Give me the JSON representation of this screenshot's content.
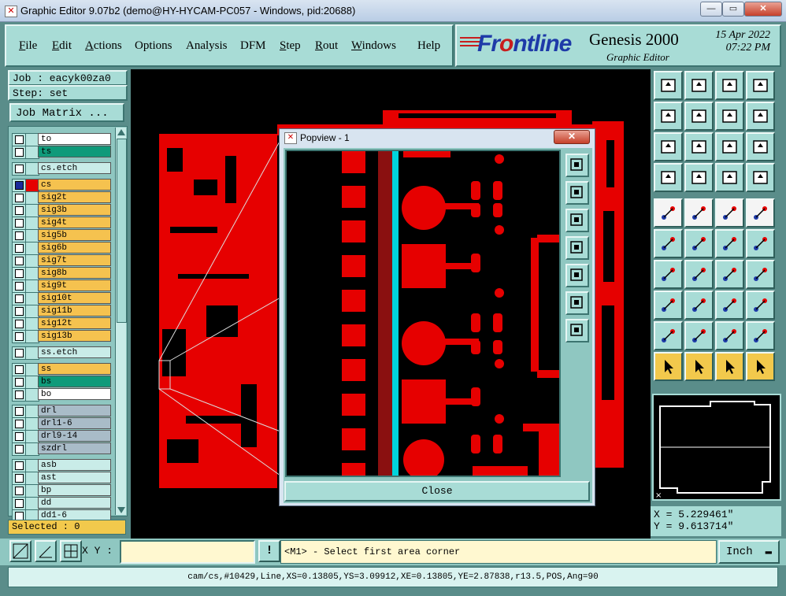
{
  "window": {
    "title": "Graphic Editor 9.07b2 (demo@HY-HYCAM-PC057 - Windows, pid:20688)",
    "app_icon": "x-icon",
    "controls": {
      "minimize": "—",
      "restore": "▭",
      "close": "✕"
    }
  },
  "menubar": {
    "items": [
      {
        "label": "File",
        "u": "F",
        "rest": "ile"
      },
      {
        "label": "Edit",
        "u": "E",
        "rest": "dit"
      },
      {
        "label": "Actions",
        "u": "A",
        "rest": "ctions"
      },
      {
        "label": "Options",
        "u": "",
        "rest": "Options"
      },
      {
        "label": "Analysis",
        "u": "",
        "rest": "Analysis"
      },
      {
        "label": "DFM",
        "u": "",
        "rest": "DFM"
      },
      {
        "label": "Step",
        "u": "S",
        "rest": "tep"
      },
      {
        "label": "Rout",
        "u": "R",
        "rest": "out"
      },
      {
        "label": "Windows",
        "u": "W",
        "rest": "indows"
      },
      {
        "label": "Help",
        "u": "",
        "rest": "Help"
      }
    ]
  },
  "logo": {
    "brand_pre": "Fr",
    "brand_o": "o",
    "brand_post": "ntline",
    "product": "Genesis 2000",
    "subtitle": "Graphic Editor",
    "date": "15 Apr 2022",
    "time": "07:22 PM"
  },
  "job": {
    "job_label": "Job : eacyk00za0",
    "step_label": "Step: set",
    "matrix_button": "Job Matrix ..."
  },
  "layers": [
    {
      "name": "to",
      "color": "#ffffff",
      "group": 1
    },
    {
      "name": "ts",
      "color": "#0f9a7a",
      "group": 1
    },
    {
      "name": "cs.etch",
      "color": "#c9ece8",
      "group": 2
    },
    {
      "name": "cs",
      "color": "#f5c24f",
      "group": 3,
      "active": true
    },
    {
      "name": "sig2t",
      "color": "#f5c24f",
      "group": 3
    },
    {
      "name": "sig3b",
      "color": "#f5c24f",
      "group": 3
    },
    {
      "name": "sig4t",
      "color": "#f5c24f",
      "group": 3
    },
    {
      "name": "sig5b",
      "color": "#f5c24f",
      "group": 3
    },
    {
      "name": "sig6b",
      "color": "#f5c24f",
      "group": 3
    },
    {
      "name": "sig7t",
      "color": "#f5c24f",
      "group": 3
    },
    {
      "name": "sig8b",
      "color": "#f5c24f",
      "group": 3
    },
    {
      "name": "sig9t",
      "color": "#f5c24f",
      "group": 3
    },
    {
      "name": "sig10t",
      "color": "#f5c24f",
      "group": 3
    },
    {
      "name": "sig11b",
      "color": "#f5c24f",
      "group": 3
    },
    {
      "name": "sig12t",
      "color": "#f5c24f",
      "group": 3
    },
    {
      "name": "sig13b",
      "color": "#f5c24f",
      "group": 3
    },
    {
      "name": "ss.etch",
      "color": "#c9ece8",
      "group": 4
    },
    {
      "name": "ss",
      "color": "#f5c24f",
      "group": 5
    },
    {
      "name": "bs",
      "color": "#0f9a7a",
      "group": 5
    },
    {
      "name": "bo",
      "color": "#ffffff",
      "group": 5
    },
    {
      "name": "drl",
      "color": "#a9bcc8",
      "group": 6
    },
    {
      "name": "drl1-6",
      "color": "#a9bcc8",
      "group": 6
    },
    {
      "name": "drl9-14",
      "color": "#a9bcc8",
      "group": 6
    },
    {
      "name": "szdrl",
      "color": "#a9bcc8",
      "group": 6
    },
    {
      "name": "asb",
      "color": "#c9ece8",
      "group": 7
    },
    {
      "name": "ast",
      "color": "#c9ece8",
      "group": 7
    },
    {
      "name": "bp",
      "color": "#c9ece8",
      "group": 7
    },
    {
      "name": "dd",
      "color": "#c9ece8",
      "group": 7
    },
    {
      "name": "dd1-6",
      "color": "#c9ece8",
      "group": 7
    }
  ],
  "selected": "Selected : 0",
  "popview": {
    "title": "Popview - 1",
    "close_button": "Close",
    "close_x": "✕"
  },
  "coords": {
    "x": "X = 5.229461\"",
    "y": "Y = 9.613714\""
  },
  "input": {
    "xy_label": "X Y :",
    "xy_value": "",
    "prompt_icon": "!",
    "prompt": "<M1> - Select first area corner",
    "unit": "Inch"
  },
  "status": "cam/cs,#10429,Line,XS=0.13805,YS=3.09912,XE=0.13805,YE=2.87838,r13.5,POS,Ang=90",
  "toolbar_icons": [
    "move-up-icon",
    "move-down-icon",
    "home-icon",
    "window-icon",
    "move-left-icon",
    "move-right-icon",
    "undo-icon",
    "redo-icon",
    "fit-icon",
    "zoom-icon",
    "ratio-icon",
    "help-icon",
    "settings-icon",
    "grid-icon",
    "layer-a-icon",
    "layer-b-icon",
    "pad-icon",
    "line-icon",
    "ruler-icon",
    "circle-icon",
    "net-icon",
    "delete-icon",
    "route-a-icon",
    "route-b-icon",
    "angle-icon",
    "brush-icon",
    "rotate-icon",
    "split-icon",
    "snap-icon",
    "cut-icon",
    "measure-icon",
    "group-icon",
    "tri-a-icon",
    "tri-b-icon",
    "tri-c-icon",
    "tri-d-icon",
    "pointer-icon",
    "pointer-box-icon",
    "pointer-move-icon",
    "connect-icon"
  ]
}
